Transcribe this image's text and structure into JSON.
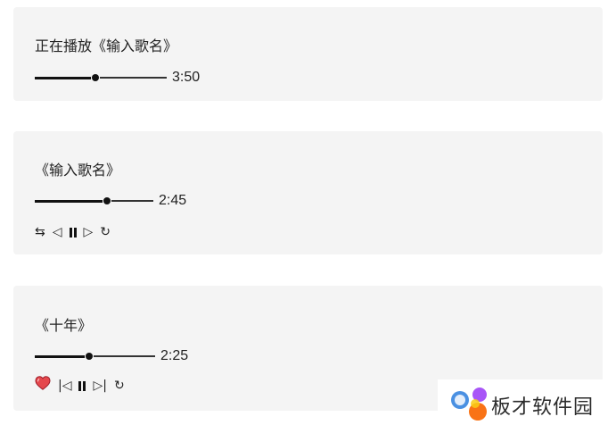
{
  "players": [
    {
      "title": "正在播放《输入歌名》",
      "progress_fraction": 0.46,
      "time": "3:50",
      "controls": []
    },
    {
      "title": "《输入歌名》",
      "progress_fraction": 0.62,
      "time": "2:45",
      "controls": [
        {
          "name": "shuffle",
          "glyph": "⇆"
        },
        {
          "name": "previous",
          "glyph": "◁"
        },
        {
          "name": "pause",
          "glyph": ""
        },
        {
          "name": "next",
          "glyph": "▷"
        },
        {
          "name": "repeat",
          "glyph": "↻"
        }
      ]
    },
    {
      "title": "《十年》",
      "progress_fraction": 0.45,
      "time": "2:25",
      "controls": [
        {
          "name": "heart",
          "glyph": ""
        },
        {
          "name": "skip-previous",
          "glyph": "|◁"
        },
        {
          "name": "pause",
          "glyph": ""
        },
        {
          "name": "skip-next",
          "glyph": "▷|"
        },
        {
          "name": "repeat",
          "glyph": "↻"
        }
      ]
    }
  ],
  "watermark": {
    "text": "板才软件园"
  },
  "colors": {
    "card_background": "#f4f4f4",
    "heart": "#e5484d"
  }
}
